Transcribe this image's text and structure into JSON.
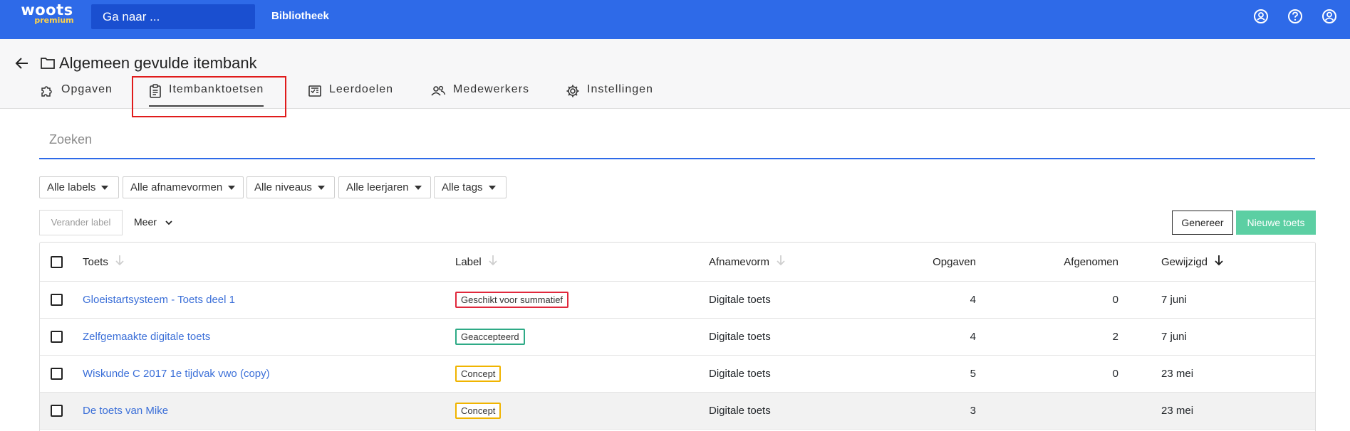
{
  "topbar": {
    "logo_main": "woots",
    "logo_sub": "premium",
    "goto_placeholder": "Ga naar ...",
    "nav_library": "Bibliotheek",
    "icons": [
      "users-circle-icon",
      "help-icon",
      "account-icon"
    ]
  },
  "header": {
    "title": "Algemeen gevulde itembank",
    "tabs": [
      {
        "label": "Opgaven",
        "icon": "puzzle-icon"
      },
      {
        "label": "Itembanktoetsen",
        "icon": "clipboard-icon",
        "active": true
      },
      {
        "label": "Leerdoelen",
        "icon": "checklist-icon"
      },
      {
        "label": "Medewerkers",
        "icon": "people-icon"
      },
      {
        "label": "Instellingen",
        "icon": "gear-icon"
      }
    ]
  },
  "search": {
    "placeholder": "Zoeken"
  },
  "filters": [
    {
      "label": "Alle labels"
    },
    {
      "label": "Alle afnamevormen"
    },
    {
      "label": "Alle niveaus"
    },
    {
      "label": "Alle leerjaren"
    },
    {
      "label": "Alle tags"
    }
  ],
  "actions": {
    "change_label": "Verander label",
    "more": "Meer",
    "generate": "Genereer",
    "new_test": "Nieuwe toets"
  },
  "table": {
    "columns": {
      "toets": "Toets",
      "label": "Label",
      "afnamevorm": "Afnamevorm",
      "opgaven": "Opgaven",
      "afgenomen": "Afgenomen",
      "gewijzigd": "Gewijzigd"
    },
    "rows": [
      {
        "name": "Gloeistartsysteem - Toets deel 1",
        "label": "Geschikt voor summatief",
        "label_color": "#e0283c",
        "afnamevorm": "Digitale toets",
        "opgaven": "4",
        "afgenomen": "0",
        "gewijzigd": "7 juni"
      },
      {
        "name": "Zelfgemaakte digitale toets",
        "label": "Geaccepteerd",
        "label_color": "#2eaa86",
        "afnamevorm": "Digitale toets",
        "opgaven": "4",
        "afgenomen": "2",
        "gewijzigd": "7 juni"
      },
      {
        "name": "Wiskunde C 2017 1e tijdvak vwo (copy)",
        "label": "Concept",
        "label_color": "#f0b400",
        "afnamevorm": "Digitale toets",
        "opgaven": "5",
        "afgenomen": "0",
        "gewijzigd": "23 mei"
      },
      {
        "name": "De toets van Mike",
        "label": "Concept",
        "label_color": "#f0b400",
        "afnamevorm": "Digitale toets",
        "opgaven": "3",
        "afgenomen": "",
        "gewijzigd": "23 mei"
      }
    ]
  },
  "colors": {
    "brand": "#2e6ae8",
    "accent_green": "#5ccfa3",
    "link": "#3b6fd8",
    "highlight": "#e01b1b"
  }
}
